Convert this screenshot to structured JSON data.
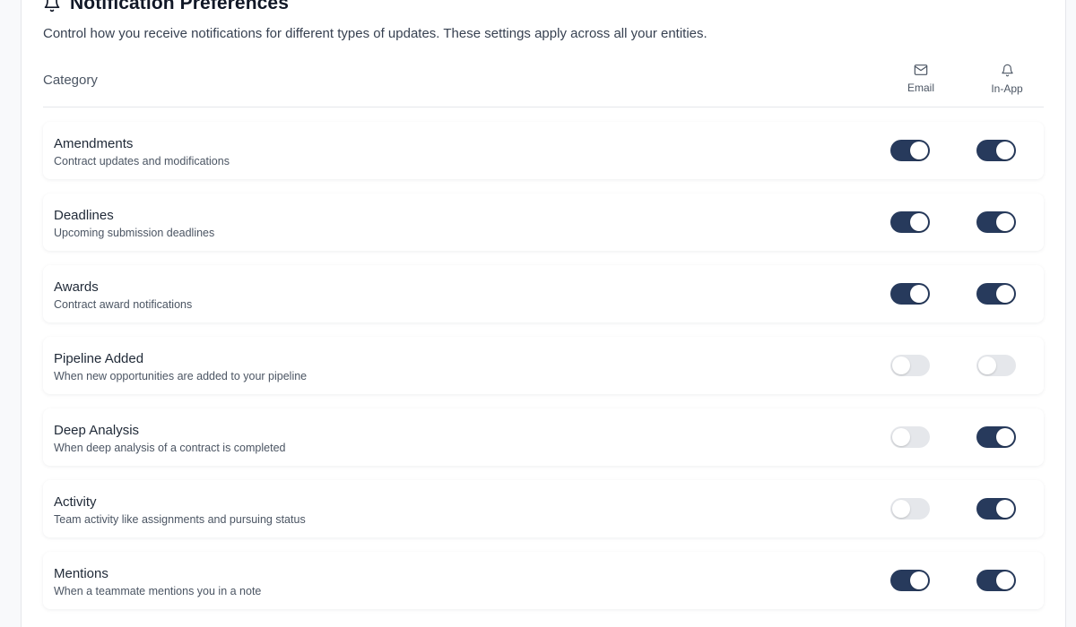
{
  "header": {
    "title": "Notification Preferences",
    "subtitle": "Control how you receive notifications for different types of updates. These settings apply across all your entities.",
    "icon": "bell-icon"
  },
  "table": {
    "category_label": "Category",
    "email_label": "Email",
    "email_icon": "mail-icon",
    "inapp_label": "In-App",
    "inapp_icon": "bell-icon"
  },
  "colors": {
    "toggle_on": "#273a5c",
    "toggle_off": "#e5e7eb"
  },
  "rows": [
    {
      "title": "Amendments",
      "description": "Contract updates and modifications",
      "email": true,
      "in_app": true
    },
    {
      "title": "Deadlines",
      "description": "Upcoming submission deadlines",
      "email": true,
      "in_app": true
    },
    {
      "title": "Awards",
      "description": "Contract award notifications",
      "email": true,
      "in_app": true
    },
    {
      "title": "Pipeline Added",
      "description": "When new opportunities are added to your pipeline",
      "email": false,
      "in_app": false
    },
    {
      "title": "Deep Analysis",
      "description": "When deep analysis of a contract is completed",
      "email": false,
      "in_app": true
    },
    {
      "title": "Activity",
      "description": "Team activity like assignments and pursuing status",
      "email": false,
      "in_app": true
    },
    {
      "title": "Mentions",
      "description": "When a teammate mentions you in a note",
      "email": true,
      "in_app": true
    }
  ]
}
